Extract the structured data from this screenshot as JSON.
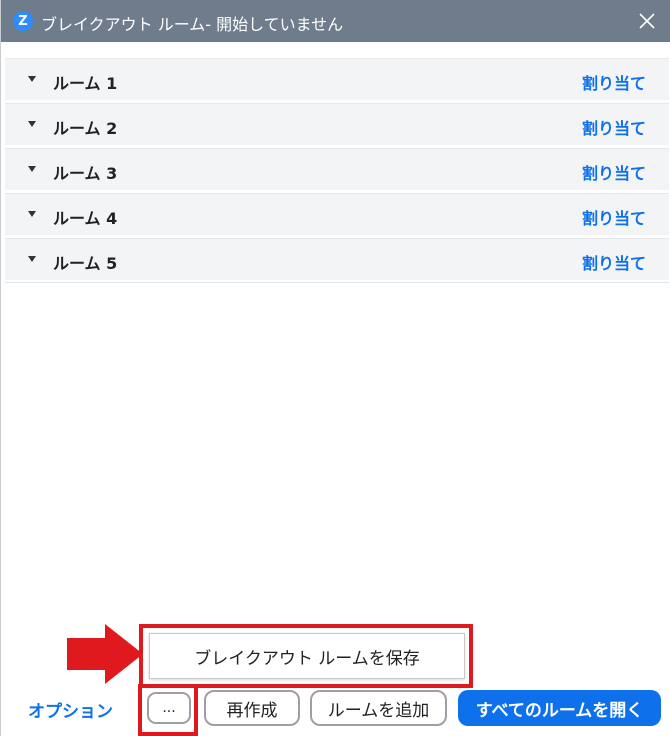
{
  "titlebar": {
    "logo_letter": "Z",
    "title": "ブレイクアウト ルーム- 開始していません"
  },
  "rooms": [
    {
      "name": "ルーム 1",
      "assign_label": "割り当て"
    },
    {
      "name": "ルーム 2",
      "assign_label": "割り当て"
    },
    {
      "name": "ルーム 3",
      "assign_label": "割り当て"
    },
    {
      "name": "ルーム 4",
      "assign_label": "割り当て"
    },
    {
      "name": "ルーム 5",
      "assign_label": "割り当て"
    }
  ],
  "footer": {
    "save_label": "ブレイクアウト ルームを保存",
    "options_label": "オプション",
    "more_label": "...",
    "recreate_label": "再作成",
    "add_room_label": "ルームを追加",
    "open_all_label": "すべてのルームを開く"
  },
  "colors": {
    "titlebar": "#6e7c8c",
    "accent": "#0e71eb",
    "highlight": "#e0191f"
  },
  "icons": {
    "close": "close-icon",
    "caret": "caret-down-icon",
    "arrow": "arrow-right-icon"
  }
}
